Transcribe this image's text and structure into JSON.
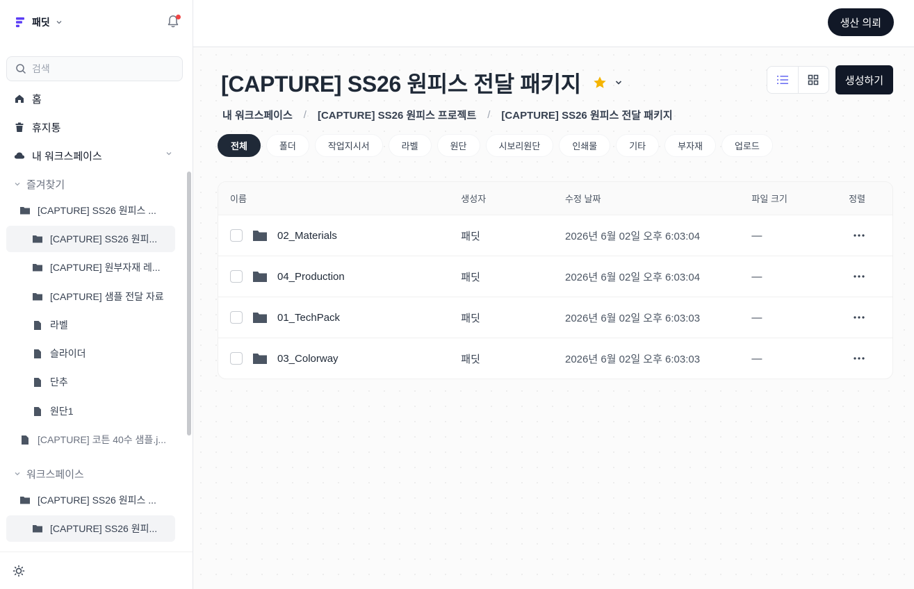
{
  "sidebar": {
    "brand": "패딧",
    "search_placeholder": "검색",
    "nav": {
      "home": "홈",
      "trash": "휴지통",
      "my_workspace": "내 워크스페이스"
    },
    "favorites": {
      "label": "즐겨찾기",
      "items": [
        "[CAPTURE] SS26 원피스 ...",
        "[CAPTURE] SS26 원피...",
        "[CAPTURE] 원부자재 레...",
        "[CAPTURE] 샘플 전달 자료",
        "라벨",
        "슬라이더",
        "단추",
        "원단1",
        "[CAPTURE] 코튼 40수 샘플.j..."
      ]
    },
    "workspace": {
      "label": "워크스페이스",
      "items": [
        "[CAPTURE] SS26 원피스 ...",
        "[CAPTURE] SS26 원피..."
      ]
    }
  },
  "header": {
    "request_button": "생산 의뢰"
  },
  "main": {
    "title": "[CAPTURE] SS26 원피스 전달 패키지",
    "create_button": "생성하기",
    "breadcrumb": [
      "내 워크스페이스",
      "[CAPTURE] SS26 원피스 프로젝트",
      "[CAPTURE] SS26 원피스 전달 패키지"
    ],
    "breadcrumb_sep": "/",
    "tabs": [
      "전체",
      "폴더",
      "작업지시서",
      "라벨",
      "원단",
      "시보리원단",
      "인쇄물",
      "기타",
      "부자재",
      "업로드"
    ],
    "active_tab": "전체",
    "table": {
      "headers": {
        "name": "이름",
        "creator": "생성자",
        "modified": "수정 날짜",
        "size": "파일 크기",
        "sort": "정렬"
      },
      "rows": [
        {
          "name": "02_Materials",
          "creator": "패딧",
          "modified": "2026년 6월 02일 오후 6:03:04",
          "size": "—"
        },
        {
          "name": "04_Production",
          "creator": "패딧",
          "modified": "2026년 6월 02일 오후 6:03:04",
          "size": "—"
        },
        {
          "name": "01_TechPack",
          "creator": "패딧",
          "modified": "2026년 6월 02일 오후 6:03:03",
          "size": "—"
        },
        {
          "name": "03_Colorway",
          "creator": "패딧",
          "modified": "2026년 6월 02일 오후 6:03:03",
          "size": "—"
        }
      ]
    }
  },
  "colors": {
    "accent": "#111827",
    "star": "#f5b400",
    "notification": "#ef4444",
    "brand_logo": "#5b3df5"
  },
  "icons": [
    "brand-logo-icon",
    "bell-icon",
    "search-icon",
    "home-icon",
    "trash-icon",
    "cloud-icon",
    "chevron-down-icon",
    "folder-icon",
    "file-icon",
    "sun-icon",
    "star-icon",
    "list-view-icon",
    "grid-view-icon",
    "more-icon"
  ]
}
